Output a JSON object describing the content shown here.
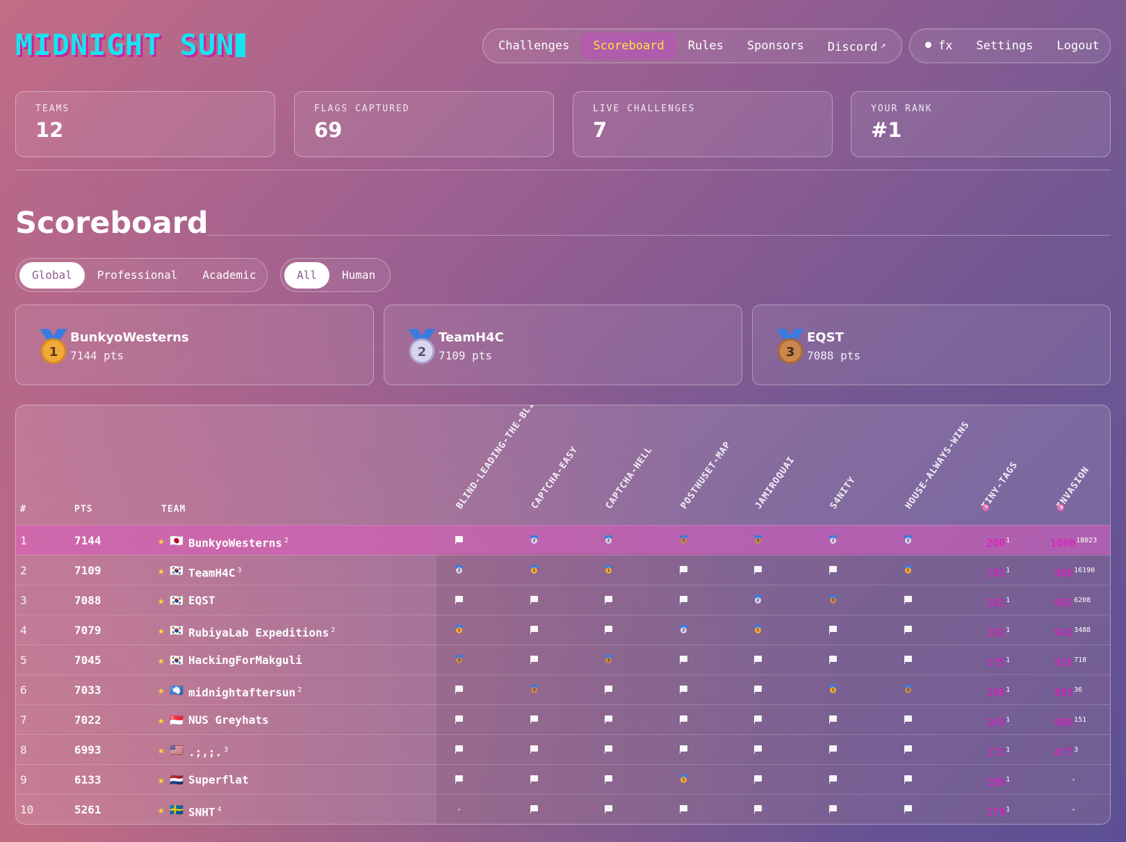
{
  "brand": {
    "logo_text": "MIDNIGHT SUN"
  },
  "nav": {
    "items": [
      "Challenges",
      "Scoreboard",
      "Rules",
      "Sponsors",
      "Discord"
    ],
    "active": "Scoreboard",
    "user": {
      "name": "fx",
      "settings": "Settings",
      "logout": "Logout"
    }
  },
  "stats": [
    {
      "label": "TEAMS",
      "value": "12"
    },
    {
      "label": "FLAGS CAPTURED",
      "value": "69"
    },
    {
      "label": "LIVE CHALLENGES",
      "value": "7"
    },
    {
      "label": "YOUR RANK",
      "value": "#1"
    }
  ],
  "page": {
    "title": "Scoreboard"
  },
  "filters": {
    "division": [
      "Global",
      "Professional",
      "Academic"
    ],
    "division_selected": "Global",
    "type": [
      "All",
      "Human"
    ],
    "type_selected": "All"
  },
  "podium": [
    {
      "place": "1",
      "name": "BunkyoWesterns",
      "pts": "7144 pts"
    },
    {
      "place": "2",
      "name": "TeamH4C",
      "pts": "7109 pts"
    },
    {
      "place": "3",
      "name": "EQST",
      "pts": "7088 pts"
    }
  ],
  "table": {
    "headers": {
      "rank": "#",
      "pts": "PTS",
      "team": "TEAM"
    },
    "challenges": [
      "BLIND-LEADING-THE-BLIND",
      "CAPTCHA-EASY",
      "CAPTCHA-HELL",
      "POSTHUSET-MAP",
      "JAMIROQUAI",
      "S4NITY",
      "HOUSE-ALWAYS-WINS",
      "TINY-TAGS",
      "INVASION"
    ],
    "rows": [
      {
        "rank": "1",
        "pts": "7144",
        "flag": "🇯🇵",
        "team": "BunkyoWesterns",
        "sup": "2",
        "me": true,
        "solves": [
          "f",
          "2",
          "2",
          "3",
          "3",
          "2",
          "2"
        ],
        "tiny": "200",
        "tiny_sup": "1",
        "inv": "1000",
        "inv_sup": "18023"
      },
      {
        "rank": "2",
        "pts": "7109",
        "flag": "🇰🇷",
        "team": "TeamH4C",
        "sup": "3",
        "solves": [
          "2",
          "1",
          "1",
          "f",
          "f",
          "f",
          "1"
        ],
        "tiny": "185",
        "tiny_sup": "1",
        "inv": "980",
        "inv_sup": "16190"
      },
      {
        "rank": "3",
        "pts": "7088",
        "flag": "🇰🇷",
        "team": "EQST",
        "sup": "",
        "solves": [
          "f",
          "f",
          "f",
          "f",
          "2",
          "3",
          "f"
        ],
        "tiny": "182",
        "tiny_sup": "1",
        "inv": "962",
        "inv_sup": "6208"
      },
      {
        "rank": "4",
        "pts": "7079",
        "flag": "🇰🇷",
        "team": "RubiyaLab Expeditions",
        "sup": "2",
        "solves": [
          "1",
          "f",
          "f",
          "2",
          "1",
          "f",
          "f"
        ],
        "tiny": "192",
        "tiny_sup": "1",
        "inv": "943",
        "inv_sup": "3488"
      },
      {
        "rank": "5",
        "pts": "7045",
        "flag": "🇰🇷",
        "team": "HackingForMakguli",
        "sup": "",
        "solves": [
          "3",
          "f",
          "3",
          "f",
          "f",
          "f",
          "f"
        ],
        "tiny": "175",
        "tiny_sup": "1",
        "inv": "926",
        "inv_sup": "718"
      },
      {
        "rank": "6",
        "pts": "7033",
        "flag": "🇦🇶",
        "team": "midnightaftersun",
        "sup": "2",
        "solves": [
          "f",
          "3",
          "f",
          "f",
          "f",
          "1",
          "3"
        ],
        "tiny": "196",
        "tiny_sup": "1",
        "inv": "893",
        "inv_sup": "36"
      },
      {
        "rank": "7",
        "pts": "7022",
        "flag": "🇸🇬",
        "team": "NUS Greyhats",
        "sup": "",
        "solves": [
          "f",
          "f",
          "f",
          "f",
          "f",
          "f",
          "f"
        ],
        "tiny": "169",
        "tiny_sup": "1",
        "inv": "909",
        "inv_sup": "151"
      },
      {
        "rank": "8",
        "pts": "6993",
        "flag": "🇺🇸",
        "team": ".;,;.",
        "sup": "3",
        "solves": [
          "f",
          "f",
          "f",
          "f",
          "f",
          "f",
          "f"
        ],
        "tiny": "172",
        "tiny_sup": "1",
        "inv": "877",
        "inv_sup": "3"
      },
      {
        "rank": "9",
        "pts": "6133",
        "flag": "🇳🇱",
        "team": "Superflat",
        "sup": "",
        "solves": [
          "f",
          "f",
          "f",
          "1",
          "f",
          "f",
          "f"
        ],
        "tiny": "189",
        "tiny_sup": "1",
        "inv": "",
        "inv_sup": ""
      },
      {
        "rank": "10",
        "pts": "5261",
        "flag": "🇸🇪",
        "team": "SNHT",
        "sup": "4",
        "solves": [
          "-",
          "f",
          "f",
          "f",
          "f",
          "f",
          "f"
        ],
        "tiny": "179",
        "tiny_sup": "1",
        "inv": "",
        "inv_sup": ""
      }
    ]
  },
  "colors": {
    "accent": "#19e3ee",
    "logo_shadow": "#d11ea0",
    "active_nav": "#ffe33d",
    "score_pink": "#e414c4",
    "star": "#ffd935"
  }
}
